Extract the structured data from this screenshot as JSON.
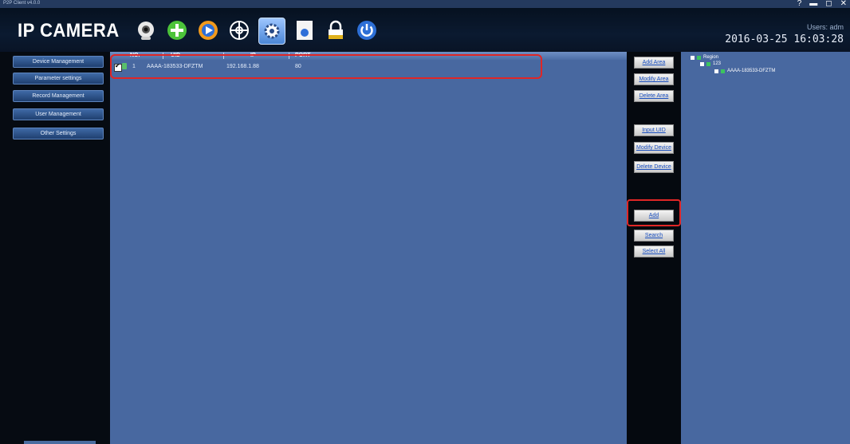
{
  "window": {
    "title": "P2P Client v4.0.0"
  },
  "header": {
    "logo": "IP CAMERA",
    "users_text": "Users: adm",
    "datetime": "2016-03-25 16:03:28"
  },
  "sidebar": {
    "items": [
      {
        "label": "Device Management"
      },
      {
        "label": "Parameter settings"
      },
      {
        "label": "Record Management"
      },
      {
        "label": "User Management"
      },
      {
        "label": "Other Settings"
      }
    ]
  },
  "table": {
    "columns": [
      "NO.",
      "UID",
      "IP",
      "PORT"
    ],
    "rows": [
      {
        "no": "1",
        "uid": "AAAA-183533-DFZTM",
        "ip": "192.168.1.88",
        "port": "80"
      }
    ]
  },
  "buttons": {
    "add_area": "Add Area",
    "modify_area": "Modify Area",
    "delete_area": "Delete Area",
    "input_uid": "Input UID",
    "modify_device": "Modify Device",
    "delete_device": "Delete Device",
    "add": "Add",
    "search": "Search",
    "select_all": "Select All"
  },
  "tree": {
    "root": "Region",
    "group": "123",
    "device": "AAAA-183533-DFZTM"
  },
  "colors": {
    "highlight": "#e02626",
    "main_bg": "#4868a0",
    "header_bg": "#0b1a30"
  }
}
